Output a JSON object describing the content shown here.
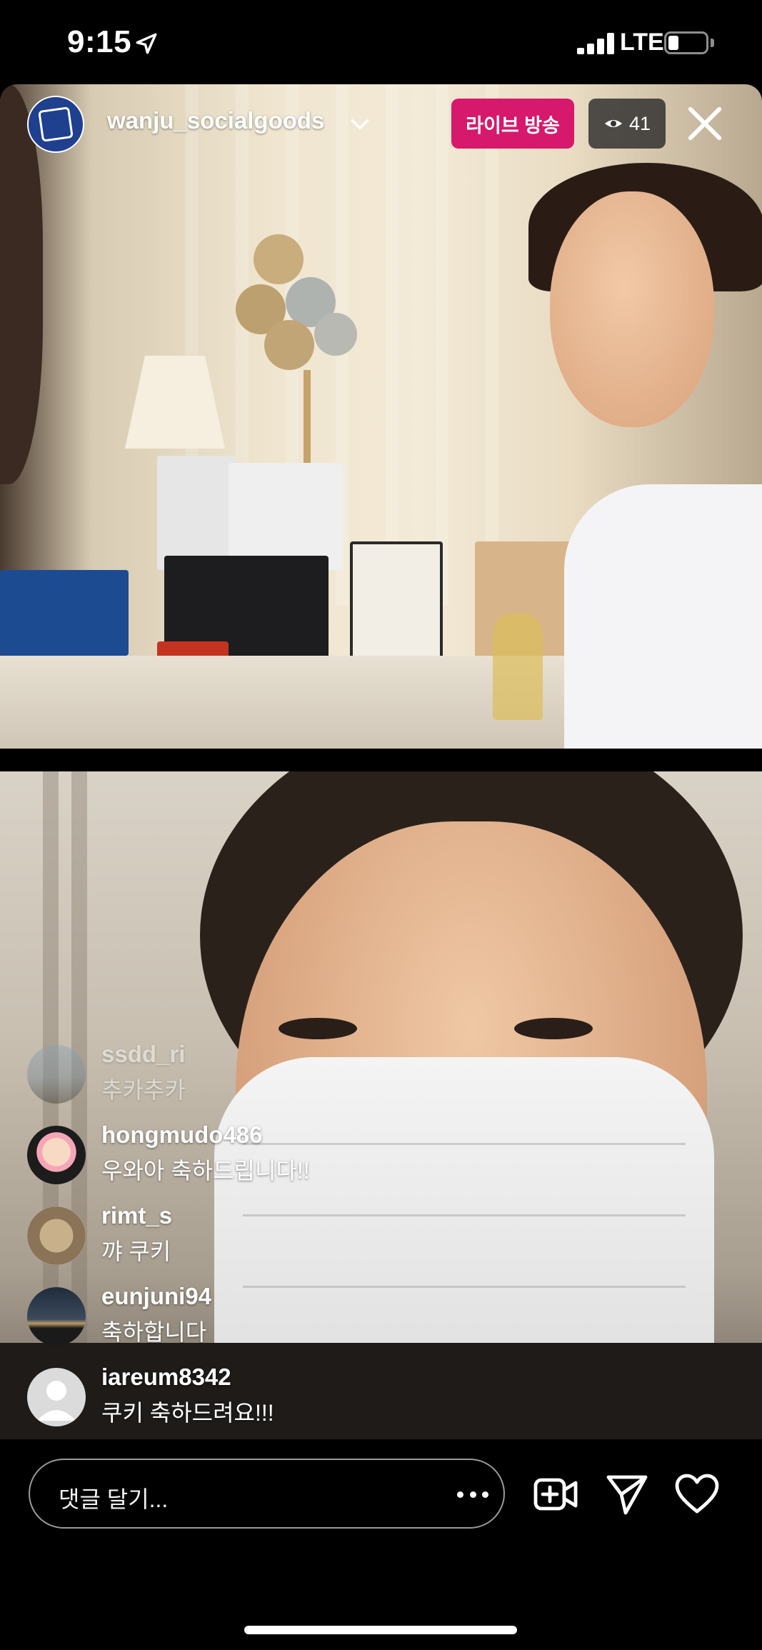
{
  "status_bar": {
    "time": "9:15",
    "network": "LTE",
    "icons": [
      "location-arrow-icon",
      "signal-icon",
      "battery-icon"
    ]
  },
  "header": {
    "username": "wanju_socialgoods",
    "live_label": "라이브 방송",
    "viewer_count": "41",
    "icons": [
      "chevron-down-icon",
      "eye-icon",
      "close-icon"
    ]
  },
  "comments": [
    {
      "username": "ssdd_ri",
      "text": "추카추카"
    },
    {
      "username": "hongmudo486",
      "text": "우와아 축하드립니다!!"
    },
    {
      "username": "rimt_s",
      "text": "꺄 쿠키"
    },
    {
      "username": "eunjuni94",
      "text": "축하합니다"
    },
    {
      "username": "iareum8342",
      "text": "쿠키 축하드려요!!!"
    }
  ],
  "composer": {
    "placeholder": "댓글 달기...",
    "actions": [
      "more-icon",
      "add-video-icon",
      "send-icon",
      "heart-icon"
    ]
  },
  "colors": {
    "live_badge": "#d6196c",
    "background": "#000000"
  }
}
